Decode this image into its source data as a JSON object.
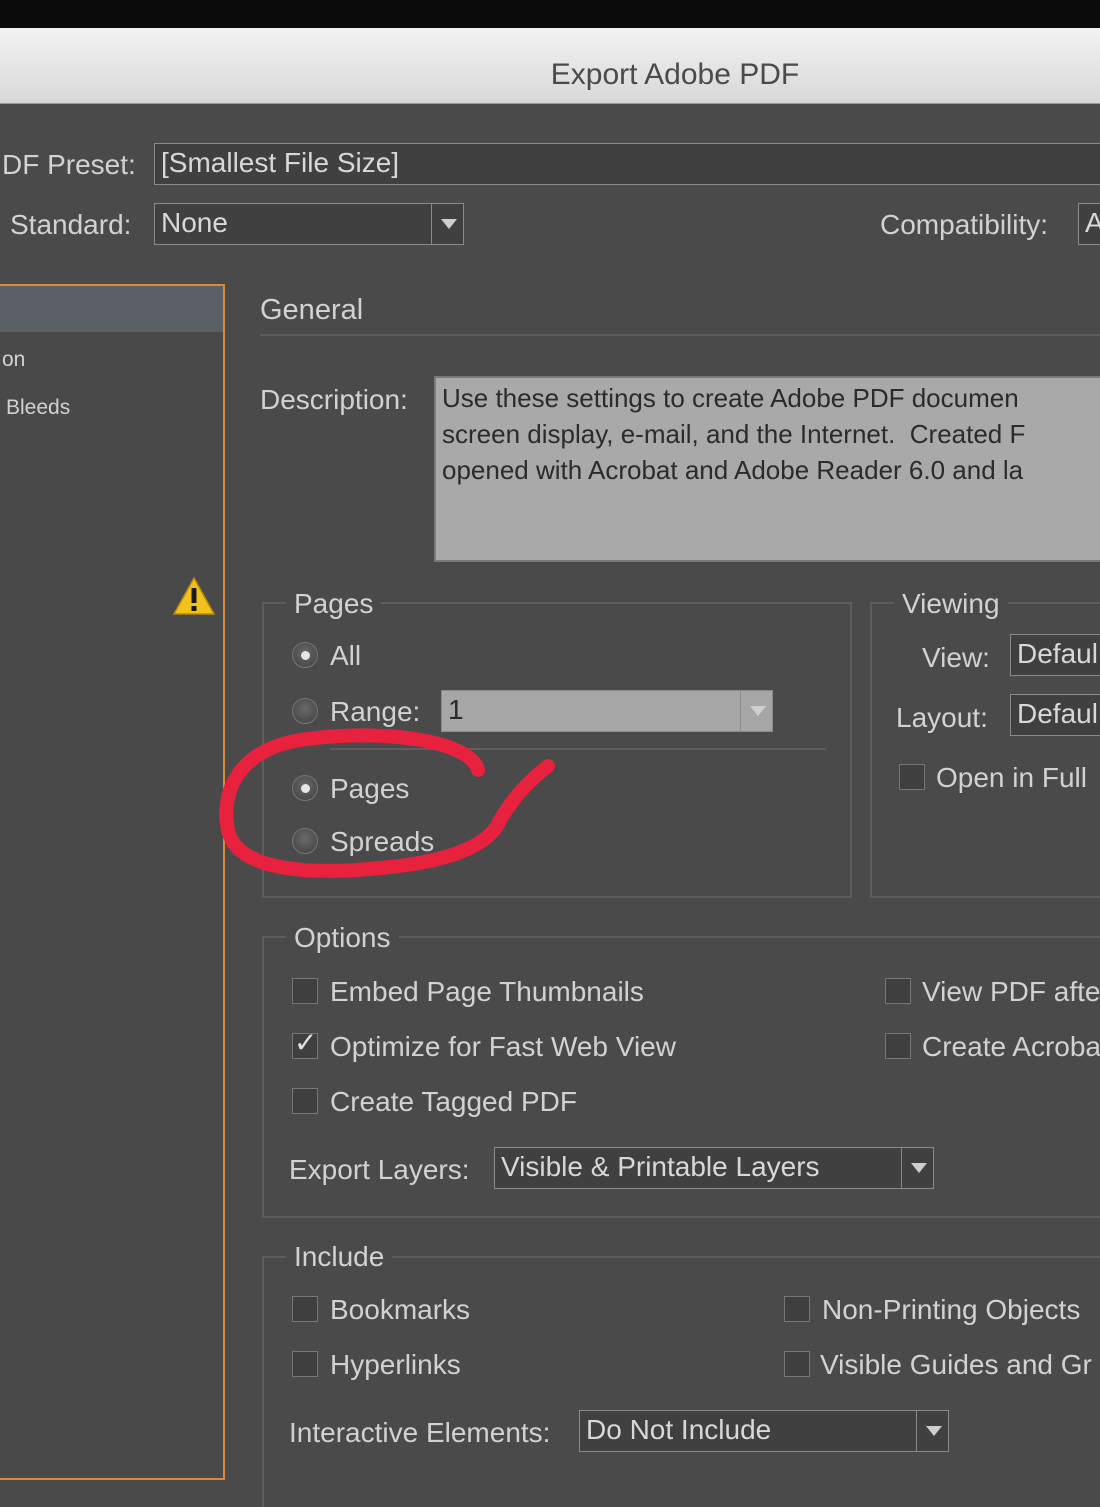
{
  "window": {
    "title": "Export Adobe PDF"
  },
  "preset": {
    "label": "DF Preset:",
    "value": "[Smallest File Size]"
  },
  "standard": {
    "label": "Standard:",
    "value": "None"
  },
  "compatibility": {
    "label": "Compatibility:",
    "value": "A"
  },
  "sidebar": {
    "items": [
      "on",
      "Bleeds"
    ]
  },
  "general": {
    "title": "General",
    "description_label": "Description:",
    "description_text": "Use these settings to create Adobe PDF documen\nscreen display, e-mail, and the Internet.  Created F\nopened with Acrobat and Adobe Reader 6.0 and la"
  },
  "pages": {
    "title": "Pages",
    "all_label": "All",
    "range_label": "Range:",
    "range_value": "1",
    "pages_label": "Pages",
    "spreads_label": "Spreads"
  },
  "viewing": {
    "title": "Viewing",
    "view_label": "View:",
    "view_value": "Defaul",
    "layout_label": "Layout:",
    "layout_value": "Defaul",
    "open_full_label": "Open in Full"
  },
  "options": {
    "title": "Options",
    "embed_thumbnails": "Embed Page Thumbnails",
    "optimize_web": "Optimize for Fast Web View",
    "tagged_pdf": "Create Tagged PDF",
    "view_pdf_after": "View PDF afte",
    "create_acrobat": "Create Acroba",
    "export_layers_label": "Export Layers:",
    "export_layers_value": "Visible & Printable Layers"
  },
  "include": {
    "title": "Include",
    "bookmarks": "Bookmarks",
    "hyperlinks": "Hyperlinks",
    "non_printing": "Non-Printing Objects",
    "visible_guides": "Visible Guides and Gr",
    "interactive_label": "Interactive Elements:",
    "interactive_value": "Do Not Include"
  },
  "colors": {
    "sidebar_border": "#d98b3c",
    "annotation": "#e8213f",
    "warning": "#f2c21b"
  }
}
